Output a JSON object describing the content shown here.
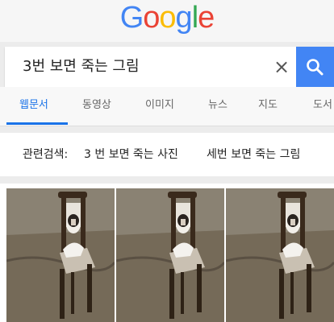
{
  "logo": {
    "text": "Google",
    "letters": [
      {
        "char": "G",
        "color": "#4285F4"
      },
      {
        "char": "o",
        "color": "#EA4335"
      },
      {
        "char": "o",
        "color": "#FBBC05"
      },
      {
        "char": "g",
        "color": "#4285F4"
      },
      {
        "char": "l",
        "color": "#34A853"
      },
      {
        "char": "e",
        "color": "#EA4335"
      }
    ]
  },
  "search": {
    "query": "3번 보면 죽는 그림",
    "clear_icon": "×",
    "button_icon": "search-icon",
    "button_color": "#4285f4"
  },
  "tabs": {
    "items": [
      "웹문서",
      "동영상",
      "이미지",
      "뉴스",
      "지도",
      "도서"
    ],
    "active_index": 0,
    "active_color": "#1a73e8"
  },
  "related": {
    "label": "관련검색:",
    "links": [
      "3 번 보면 죽는 사진",
      "세번 보면 죽는 그림"
    ]
  },
  "images": {
    "count": 3,
    "subject": "ghost-on-chair-painting"
  }
}
